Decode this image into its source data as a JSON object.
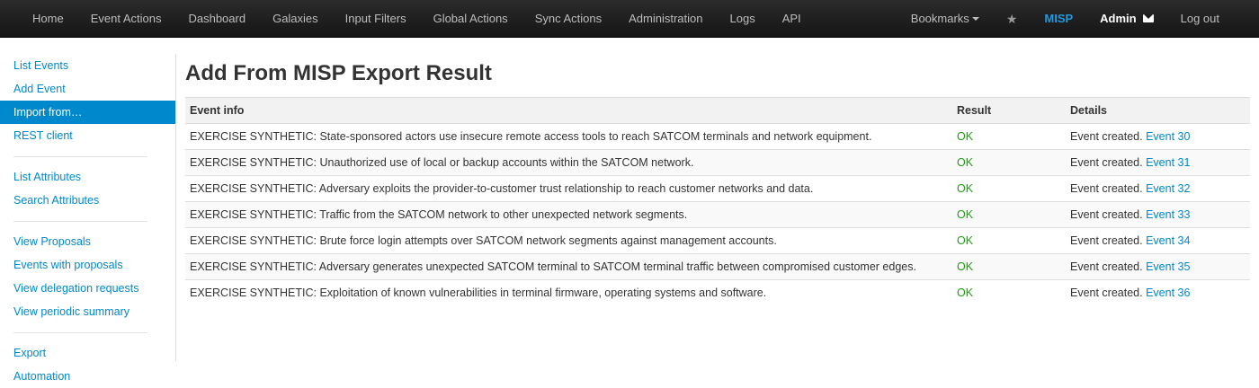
{
  "navbar": {
    "left_items": [
      "Home",
      "Event Actions",
      "Dashboard",
      "Galaxies",
      "Input Filters",
      "Global Actions",
      "Sync Actions",
      "Administration",
      "Logs",
      "API"
    ],
    "bookmarks": "Bookmarks",
    "star_icon": "star-icon",
    "brand": "MISP",
    "user": "Admin",
    "logout": "Log out"
  },
  "sidebar": {
    "groups": [
      [
        "List Events",
        "Add Event",
        "Import from…",
        "REST client"
      ],
      [
        "List Attributes",
        "Search Attributes"
      ],
      [
        "View Proposals",
        "Events with proposals",
        "View delegation requests",
        "View periodic summary"
      ],
      [
        "Export",
        "Automation"
      ]
    ],
    "active": "Import from…"
  },
  "page": {
    "title": "Add From MISP Export Result"
  },
  "table": {
    "headers": [
      "Event info",
      "Result",
      "Details"
    ],
    "detail_prefix": "Event created.",
    "rows": [
      {
        "info": "EXERCISE SYNTHETIC: State-sponsored actors use insecure remote access tools to reach SATCOM terminals and network equipment.",
        "result": "OK",
        "link": "Event 30"
      },
      {
        "info": "EXERCISE SYNTHETIC: Unauthorized use of local or backup accounts within the SATCOM network.",
        "result": "OK",
        "link": "Event 31"
      },
      {
        "info": "EXERCISE SYNTHETIC: Adversary exploits the provider-to-customer trust relationship to reach customer networks and data.",
        "result": "OK",
        "link": "Event 32"
      },
      {
        "info": "EXERCISE SYNTHETIC: Traffic from the SATCOM network to other unexpected network segments.",
        "result": "OK",
        "link": "Event 33"
      },
      {
        "info": "EXERCISE SYNTHETIC: Brute force login attempts over SATCOM network segments against management accounts.",
        "result": "OK",
        "link": "Event 34"
      },
      {
        "info": "EXERCISE SYNTHETIC: Adversary generates unexpected SATCOM terminal to SATCOM terminal traffic between compromised customer edges.",
        "result": "OK",
        "link": "Event 35"
      },
      {
        "info": "EXERCISE SYNTHETIC: Exploitation of known vulnerabilities in terminal firmware, operating systems and software.",
        "result": "OK",
        "link": "Event 36"
      }
    ]
  },
  "colors": {
    "accent": "#0088cc",
    "brand": "#1f9ae0",
    "ok": "#19a00e"
  }
}
